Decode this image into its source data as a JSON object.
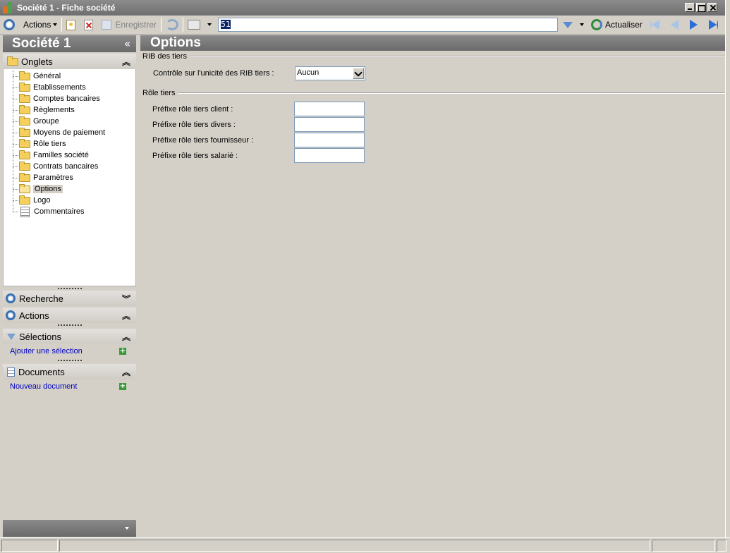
{
  "window": {
    "title": "Société 1 -  Fiche société"
  },
  "toolbar": {
    "actions_label": "Actions",
    "save_label": "Enregistrer",
    "search_value": "51",
    "refresh_label": "Actualiser"
  },
  "sidebar": {
    "title": "Société 1",
    "collapse_glyph": "«",
    "tabs_header": "Onglets",
    "tree_items": [
      "Général",
      "Etablissements",
      "Comptes bancaires",
      "Règlements",
      "Groupe",
      "Moyens de paiement",
      "Rôle tiers",
      "Familles société",
      "Contrats bancaires",
      "Paramètres",
      "Options",
      "Logo",
      "Commentaires"
    ],
    "selected_item": "Options",
    "search_header": "Recherche",
    "actions_header": "Actions",
    "selections_header": "Sélections",
    "add_selection_link": "Ajouter une sélection",
    "documents_header": "Documents",
    "new_document_link": "Nouveau document"
  },
  "content": {
    "title": "Options",
    "rib_group": "RIB des tiers",
    "rib_control_label": "Contrôle sur l'unicité des RIB tiers :",
    "rib_control_value": "Aucun",
    "role_group": "Rôle tiers",
    "prefix_client_label": "Préfixe rôle tiers client :",
    "prefix_divers_label": "Préfixe rôle tiers divers :",
    "prefix_fournisseur_label": "Préfixe rôle tiers fournisseur :",
    "prefix_salarie_label": "Préfixe rôle tiers salarié :",
    "prefix_client_value": "",
    "prefix_divers_value": "",
    "prefix_fournisseur_value": "",
    "prefix_salarie_value": ""
  },
  "colors": {
    "header_gray": "#7a7a7a",
    "link_blue": "#0000c0",
    "background": "#d4d0c8"
  }
}
